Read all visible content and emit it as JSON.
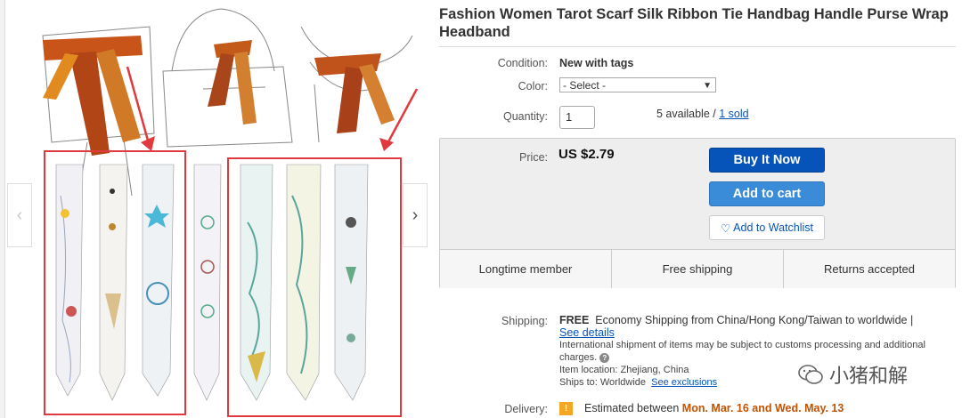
{
  "product": {
    "title": "Fashion Women Tarot Scarf Silk Ribbon Tie Handbag Handle Purse Wrap Headband"
  },
  "details": {
    "condition_label": "Condition:",
    "condition_value": "New with tags",
    "color_label": "Color:",
    "color_select": "- Select -",
    "quantity_label": "Quantity:",
    "quantity_value": "1",
    "available": "5 available",
    "separator": " / ",
    "sold": "1 sold"
  },
  "price": {
    "label": "Price:",
    "value": "US $2.79"
  },
  "buttons": {
    "buy_now": "Buy It Now",
    "add_to_cart": "Add to cart",
    "watchlist": "Add to Watchlist"
  },
  "badges": [
    "Longtime member",
    "Free shipping",
    "Returns accepted"
  ],
  "shipping": {
    "label": "Shipping:",
    "free": "FREE",
    "method": "Economy Shipping from China/Hong Kong/Taiwan to worldwide |",
    "see_details": "See details",
    "intl_note": "International shipment of items may be subject to customs processing and additional charges.",
    "item_location": "Item location:  Zhejiang, China",
    "ships_to": "Ships to:  Worldwide",
    "see_exclusions": "See exclusions"
  },
  "delivery": {
    "label": "Delivery:",
    "text": "Estimated between",
    "dates": "Mon. Mar. 16 and Wed. May. 13"
  },
  "watermark": {
    "text": "小猪和解"
  },
  "colors": {
    "buy_blue": "#0654ba",
    "cart_blue": "#3a8bd8",
    "highlight_red": "#e0393e",
    "delivery_orange": "#c45200"
  }
}
